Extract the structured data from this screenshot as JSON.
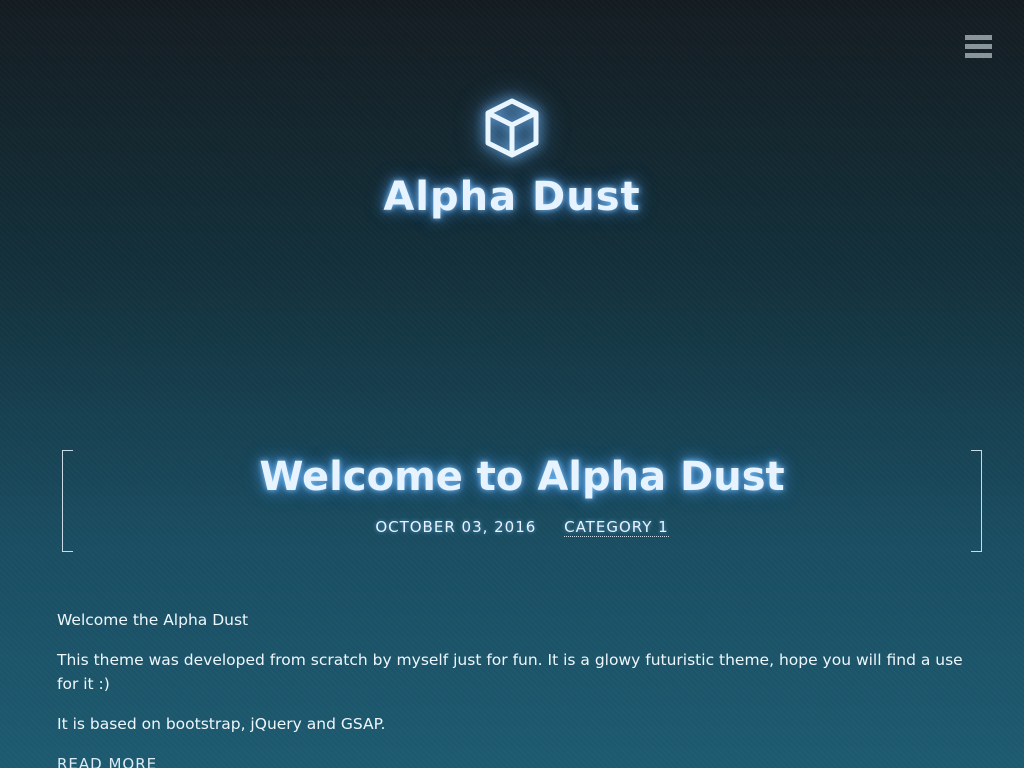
{
  "header": {
    "logo_icon": "cube-icon",
    "site_title": "Alpha Dust"
  },
  "nav": {
    "menu_icon": "hamburger-menu-icon"
  },
  "post": {
    "title": "Welcome to Alpha Dust",
    "date": "OCTOBER 03, 2016",
    "category": "CATEGORY 1",
    "paragraphs": [
      "Welcome the Alpha Dust",
      "This theme was developed from scratch by myself just for fun. It is a glowy futuristic theme, hope you will find a use for it :)",
      "It is based on bootstrap, jQuery and GSAP."
    ],
    "read_more": "READ MORE"
  },
  "colors": {
    "glow": "#7fc4ff",
    "text": "#e7f3ff",
    "background_top": "#141c21",
    "background_bottom": "#1d5a70"
  }
}
